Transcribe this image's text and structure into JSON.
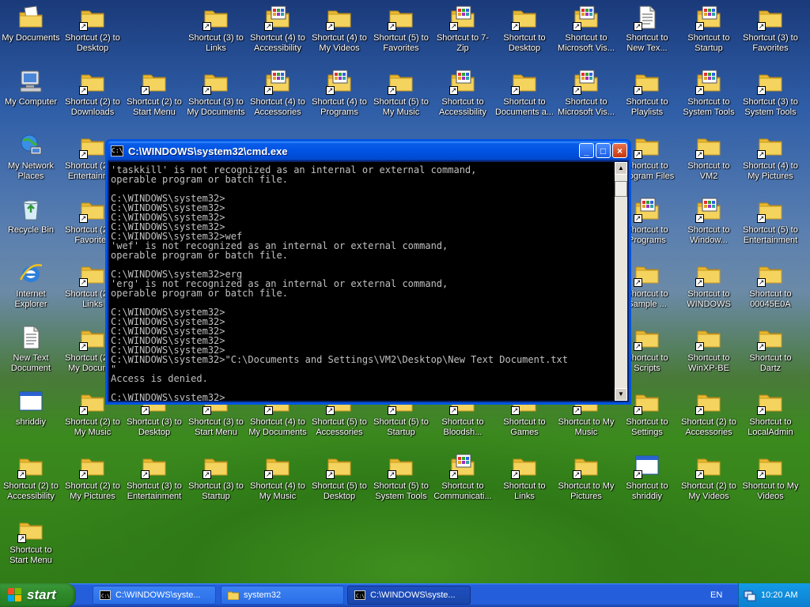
{
  "desktop_icons": [
    {
      "col": 0,
      "row": 0,
      "label": "My Documents",
      "icon": "my-documents-icon",
      "shortcut": false
    },
    {
      "col": 1,
      "row": 0,
      "label": "Shortcut (2) to Desktop",
      "icon": "folder-icon",
      "shortcut": true
    },
    {
      "col": 3,
      "row": 0,
      "label": "Shortcut (3) to Links",
      "icon": "folder-icon",
      "shortcut": true
    },
    {
      "col": 4,
      "row": 0,
      "label": "Shortcut (4) to Accessibility",
      "icon": "program-group-icon",
      "shortcut": true
    },
    {
      "col": 5,
      "row": 0,
      "label": "Shortcut (4) to My Videos",
      "icon": "folder-icon",
      "shortcut": true
    },
    {
      "col": 6,
      "row": 0,
      "label": "Shortcut (5) to Favorites",
      "icon": "folder-icon",
      "shortcut": true
    },
    {
      "col": 7,
      "row": 0,
      "label": "Shortcut to 7-Zip",
      "icon": "program-group-icon",
      "shortcut": true
    },
    {
      "col": 8,
      "row": 0,
      "label": "Shortcut to Desktop",
      "icon": "folder-icon",
      "shortcut": true
    },
    {
      "col": 9,
      "row": 0,
      "label": "Shortcut to Microsoft Vis...",
      "icon": "program-group-icon",
      "shortcut": true
    },
    {
      "col": 10,
      "row": 0,
      "label": "Shortcut to New Tex...",
      "icon": "text-document-icon",
      "shortcut": true
    },
    {
      "col": 11,
      "row": 0,
      "label": "Shortcut to Startup",
      "icon": "program-group-icon",
      "shortcut": true
    },
    {
      "col": 12,
      "row": 0,
      "label": "Shortcut (3) to Favorites",
      "icon": "folder-icon",
      "shortcut": true
    },
    {
      "col": 0,
      "row": 1,
      "label": "My Computer",
      "icon": "my-computer-icon",
      "shortcut": false
    },
    {
      "col": 1,
      "row": 1,
      "label": "Shortcut (2) to Downloads",
      "icon": "folder-icon",
      "shortcut": true
    },
    {
      "col": 2,
      "row": 1,
      "label": "Shortcut (2) to Start Menu",
      "icon": "folder-icon",
      "shortcut": true
    },
    {
      "col": 3,
      "row": 1,
      "label": "Shortcut (3) to My Documents",
      "icon": "folder-icon",
      "shortcut": true
    },
    {
      "col": 4,
      "row": 1,
      "label": "Shortcut (4) to Accessories",
      "icon": "program-group-icon",
      "shortcut": true
    },
    {
      "col": 5,
      "row": 1,
      "label": "Shortcut (4) to Programs",
      "icon": "program-group-icon",
      "shortcut": true
    },
    {
      "col": 6,
      "row": 1,
      "label": "Shortcut (5) to My Music",
      "icon": "folder-icon",
      "shortcut": true
    },
    {
      "col": 7,
      "row": 1,
      "label": "Shortcut to Accessibility",
      "icon": "program-group-icon",
      "shortcut": true
    },
    {
      "col": 8,
      "row": 1,
      "label": "Shortcut to Documents a...",
      "icon": "folder-icon",
      "shortcut": true
    },
    {
      "col": 9,
      "row": 1,
      "label": "Shortcut to Microsoft Vis...",
      "icon": "program-group-icon",
      "shortcut": true
    },
    {
      "col": 10,
      "row": 1,
      "label": "Shortcut to Playlists",
      "icon": "folder-icon",
      "shortcut": true
    },
    {
      "col": 11,
      "row": 1,
      "label": "Shortcut to System Tools",
      "icon": "program-group-icon",
      "shortcut": true
    },
    {
      "col": 12,
      "row": 1,
      "label": "Shortcut (3) to System Tools",
      "icon": "folder-icon",
      "shortcut": true
    },
    {
      "col": 0,
      "row": 2,
      "label": "My Network Places",
      "icon": "network-places-icon",
      "shortcut": false
    },
    {
      "col": 1,
      "row": 2,
      "label": "Shortcut (2) to Entertainm...",
      "icon": "folder-icon",
      "shortcut": true
    },
    {
      "col": 10,
      "row": 2,
      "label": "Shortcut to Program Files",
      "icon": "folder-icon",
      "shortcut": true
    },
    {
      "col": 11,
      "row": 2,
      "label": "Shortcut to VM2",
      "icon": "folder-icon",
      "shortcut": true
    },
    {
      "col": 12,
      "row": 2,
      "label": "Shortcut (4) to My Pictures",
      "icon": "folder-icon",
      "shortcut": true
    },
    {
      "col": 0,
      "row": 3,
      "label": "Recycle Bin",
      "icon": "recycle-bin-icon",
      "shortcut": false
    },
    {
      "col": 1,
      "row": 3,
      "label": "Shortcut (2) to Favorites",
      "icon": "folder-icon",
      "shortcut": true
    },
    {
      "col": 10,
      "row": 3,
      "label": "Shortcut to Programs",
      "icon": "program-group-icon",
      "shortcut": true
    },
    {
      "col": 11,
      "row": 3,
      "label": "Shortcut to Window...",
      "icon": "program-group-icon",
      "shortcut": true
    },
    {
      "col": 12,
      "row": 3,
      "label": "Shortcut (5) to Entertainment",
      "icon": "folder-icon",
      "shortcut": true
    },
    {
      "col": 0,
      "row": 4,
      "label": "Internet Explorer",
      "icon": "internet-explorer-icon",
      "shortcut": false
    },
    {
      "col": 1,
      "row": 4,
      "label": "Shortcut (2) to Links",
      "icon": "folder-icon",
      "shortcut": true
    },
    {
      "col": 10,
      "row": 4,
      "label": "Shortcut to Sample ...",
      "icon": "folder-icon",
      "shortcut": true
    },
    {
      "col": 11,
      "row": 4,
      "label": "Shortcut to WINDOWS",
      "icon": "folder-icon",
      "shortcut": true
    },
    {
      "col": 12,
      "row": 4,
      "label": "Shortcut to 00045E0A",
      "icon": "folder-icon",
      "shortcut": true
    },
    {
      "col": 0,
      "row": 5,
      "label": "New Text Document",
      "icon": "text-document-icon",
      "shortcut": false
    },
    {
      "col": 1,
      "row": 5,
      "label": "Shortcut (2) to My Docum...",
      "icon": "folder-icon",
      "shortcut": true
    },
    {
      "col": 10,
      "row": 5,
      "label": "Shortcut to Scripts",
      "icon": "folder-icon",
      "shortcut": true
    },
    {
      "col": 11,
      "row": 5,
      "label": "Shortcut to WinXP-BE",
      "icon": "folder-icon",
      "shortcut": true
    },
    {
      "col": 12,
      "row": 5,
      "label": "Shortcut to Dartz",
      "icon": "folder-icon",
      "shortcut": true
    },
    {
      "col": 0,
      "row": 6,
      "label": "shriddiy",
      "icon": "window-app-icon",
      "shortcut": false
    },
    {
      "col": 1,
      "row": 6,
      "label": "Shortcut (2) to My Music",
      "icon": "folder-icon",
      "shortcut": true
    },
    {
      "col": 2,
      "row": 6,
      "label": "Shortcut (3) to Desktop",
      "icon": "folder-icon",
      "shortcut": true
    },
    {
      "col": 3,
      "row": 6,
      "label": "Shortcut (3) to Start Menu",
      "icon": "folder-icon",
      "shortcut": true
    },
    {
      "col": 4,
      "row": 6,
      "label": "Shortcut (4) to My Documents",
      "icon": "folder-icon",
      "shortcut": true
    },
    {
      "col": 5,
      "row": 6,
      "label": "Shortcut (5) to Accessories",
      "icon": "folder-icon",
      "shortcut": true
    },
    {
      "col": 6,
      "row": 6,
      "label": "Shortcut (5) to Startup",
      "icon": "folder-icon",
      "shortcut": true
    },
    {
      "col": 7,
      "row": 6,
      "label": "Shortcut to Bloodsh...",
      "icon": "folder-icon",
      "shortcut": true
    },
    {
      "col": 8,
      "row": 6,
      "label": "Shortcut to Games",
      "icon": "folder-icon",
      "shortcut": true
    },
    {
      "col": 9,
      "row": 6,
      "label": "Shortcut to My Music",
      "icon": "folder-icon",
      "shortcut": true
    },
    {
      "col": 10,
      "row": 6,
      "label": "Shortcut to Settings",
      "icon": "folder-icon",
      "shortcut": true
    },
    {
      "col": 11,
      "row": 6,
      "label": "Shortcut (2) to Accessories",
      "icon": "folder-icon",
      "shortcut": true
    },
    {
      "col": 12,
      "row": 6,
      "label": "Shortcut to LocalAdmin",
      "icon": "folder-icon",
      "shortcut": true
    },
    {
      "col": 0,
      "row": 7,
      "label": "Shortcut (2) to Accessibility",
      "icon": "folder-icon",
      "shortcut": true
    },
    {
      "col": 1,
      "row": 7,
      "label": "Shortcut (2) to My Pictures",
      "icon": "folder-icon",
      "shortcut": true
    },
    {
      "col": 2,
      "row": 7,
      "label": "Shortcut (3) to Entertainment",
      "icon": "folder-icon",
      "shortcut": true
    },
    {
      "col": 3,
      "row": 7,
      "label": "Shortcut (3) to Startup",
      "icon": "folder-icon",
      "shortcut": true
    },
    {
      "col": 4,
      "row": 7,
      "label": "Shortcut (4) to My Music",
      "icon": "folder-icon",
      "shortcut": true
    },
    {
      "col": 5,
      "row": 7,
      "label": "Shortcut (5) to Desktop",
      "icon": "folder-icon",
      "shortcut": true
    },
    {
      "col": 6,
      "row": 7,
      "label": "Shortcut (5) to System Tools",
      "icon": "folder-icon",
      "shortcut": true
    },
    {
      "col": 7,
      "row": 7,
      "label": "Shortcut to Communicati...",
      "icon": "program-group-icon",
      "shortcut": true
    },
    {
      "col": 8,
      "row": 7,
      "label": "Shortcut to Links",
      "icon": "folder-icon",
      "shortcut": true
    },
    {
      "col": 9,
      "row": 7,
      "label": "Shortcut to My Pictures",
      "icon": "folder-icon",
      "shortcut": true
    },
    {
      "col": 10,
      "row": 7,
      "label": "Shortcut to shriddiy",
      "icon": "window-app-icon",
      "shortcut": true
    },
    {
      "col": 11,
      "row": 7,
      "label": "Shortcut (2) to My Videos",
      "icon": "folder-icon",
      "shortcut": true
    },
    {
      "col": 12,
      "row": 7,
      "label": "Shortcut to My Videos",
      "icon": "folder-icon",
      "shortcut": true
    },
    {
      "col": 0,
      "row": 8,
      "label": "Shortcut to Start Menu",
      "icon": "folder-icon",
      "shortcut": true
    }
  ],
  "cmd_window": {
    "title": "C:\\WINDOWS\\system32\\cmd.exe",
    "lines": [
      "'taskkill' is not recognized as an internal or external command,",
      "operable program or batch file.",
      "",
      "C:\\WINDOWS\\system32>",
      "C:\\WINDOWS\\system32>",
      "C:\\WINDOWS\\system32>",
      "C:\\WINDOWS\\system32>",
      "C:\\WINDOWS\\system32>wef",
      "'wef' is not recognized as an internal or external command,",
      "operable program or batch file.",
      "",
      "C:\\WINDOWS\\system32>erg",
      "'erg' is not recognized as an internal or external command,",
      "operable program or batch file.",
      "",
      "C:\\WINDOWS\\system32>",
      "C:\\WINDOWS\\system32>",
      "C:\\WINDOWS\\system32>",
      "C:\\WINDOWS\\system32>",
      "C:\\WINDOWS\\system32>",
      "C:\\WINDOWS\\system32>\"C:\\Documents and Settings\\VM2\\Desktop\\New Text Document.txt",
      "\"",
      "Access is denied.",
      "",
      "C:\\WINDOWS\\system32>_"
    ]
  },
  "taskbar": {
    "start_label": "start",
    "tasks": [
      {
        "label": "C:\\WINDOWS\\syste...",
        "icon": "cmd-icon",
        "active": false
      },
      {
        "label": "system32",
        "icon": "folder-icon",
        "active": false
      },
      {
        "label": "C:\\WINDOWS\\syste...",
        "icon": "cmd-icon",
        "active": true
      }
    ],
    "language": "EN",
    "clock": "10:20 AM"
  },
  "colors": {
    "folder": "#f4d35e",
    "taskbar": "#245edb",
    "start": "#2f8a2a",
    "console_text": "#c0c0c0"
  }
}
